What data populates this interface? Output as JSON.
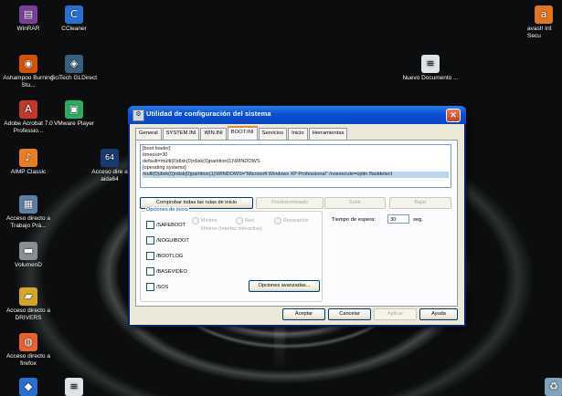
{
  "desktop": {
    "icons": [
      {
        "label": "WinRAR",
        "icon": "winrar-icon",
        "color": "#7a3f9e",
        "glyph": "▤"
      },
      {
        "label": "CCleaner",
        "icon": "ccleaner-icon",
        "color": "#2a6fd0",
        "glyph": "C"
      },
      {
        "label": "Ashampoo Burning Stu...",
        "icon": "ashampoo-icon",
        "color": "#d35400",
        "glyph": "◉"
      },
      {
        "label": "SciTech GLDirect",
        "icon": "gldirect-icon",
        "color": "#3b5f7a",
        "glyph": "◈"
      },
      {
        "label": "Adobe Acrobat 7.0 Professio...",
        "icon": "acrobat-icon",
        "color": "#c0392b",
        "glyph": "A"
      },
      {
        "label": "VMware Player",
        "icon": "vmware-icon",
        "color": "#27ae60",
        "glyph": "▣"
      },
      {
        "label": "AIMP Classic",
        "icon": "aimp-icon",
        "color": "#e67e22",
        "glyph": "♪"
      },
      {
        "label": "Acceso dire a aida64",
        "icon": "aida64-icon",
        "color": "#1a3a70",
        "glyph": "64"
      },
      {
        "label": "Acceso directo a Trabajo Prá...",
        "icon": "shortcut-doc-icon",
        "color": "#5d7fa8",
        "glyph": "▦"
      },
      {
        "label": "VolumenD",
        "icon": "drive-icon",
        "color": "#8a8f96",
        "glyph": "▬"
      },
      {
        "label": "Acceso directo a DRIVERS",
        "icon": "folder-icon",
        "color": "#d4a62a",
        "glyph": "▰"
      },
      {
        "label": "Acceso directo a firefox",
        "icon": "firefox-icon",
        "color": "#e8622c",
        "glyph": "◍"
      },
      {
        "label": "Nuevo Documento ...",
        "icon": "text-document-icon",
        "color": "#dfe3e6",
        "glyph": "≡"
      },
      {
        "label": "avast! Int Secu",
        "icon": "avast-icon",
        "color": "#e0761f",
        "glyph": "a"
      }
    ]
  },
  "dialog": {
    "title": "Utilidad de configuración del sistema",
    "tabs": [
      "General",
      "SYSTEM.INI",
      "WIN.INI",
      "BOOT.INI",
      "Servicios",
      "Inicio",
      "Herramientas"
    ],
    "active_tab": "BOOT.INI",
    "bootini_lines": [
      "[boot loader]",
      "timeout=30",
      "default=multi(0)disk(0)rdisk(0)partition(1)\\WINDOWS",
      "[operating systems]",
      "multi(0)disk(0)rdisk(0)partition(1)\\WINDOWS=\"Microsoft Windows XP Professional\" /noexecute=optin /fastdetect"
    ],
    "buttons": {
      "check_paths": "Comprobar todas las rutas de inicio",
      "default": "Predeterminado",
      "up": "Subir",
      "down": "Bajar",
      "advanced": "Opciones avanzadas...",
      "ok": "Aceptar",
      "cancel": "Cancelar",
      "apply": "Aplicar",
      "help": "Ayuda"
    },
    "boot_options_label": "Opciones de inicio",
    "checkboxes": [
      "/SAFEBOOT",
      "/NOGUIBOOT",
      "/BOOTLOG",
      "/BASEVIDEO",
      "/SOS"
    ],
    "radios": [
      "Mínimo",
      "Red",
      "Reparación",
      "Mínimo (Interfaz interactiva)"
    ],
    "timeout_label": "Tiempo de espera:",
    "timeout_value": "30",
    "timeout_unit": "seg."
  }
}
